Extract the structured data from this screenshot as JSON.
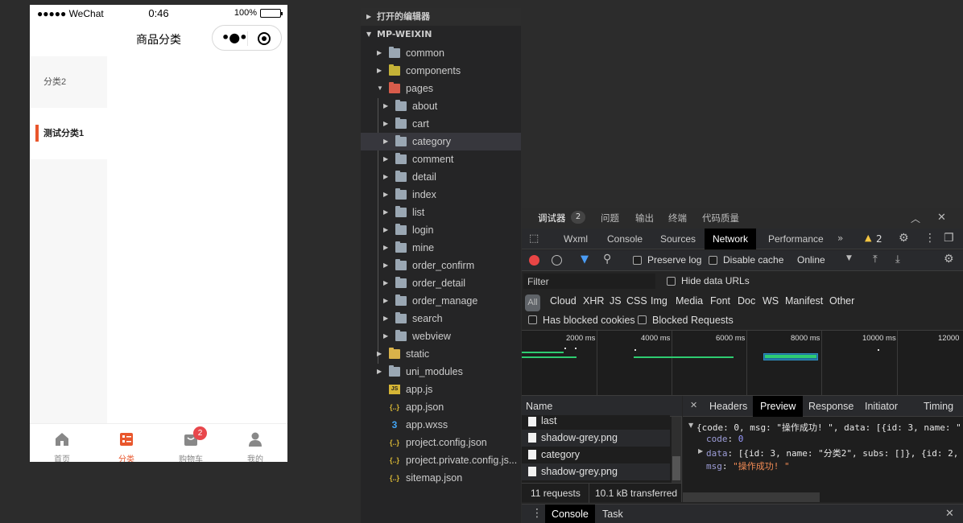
{
  "phone": {
    "status": {
      "signal": "●●●●● WeChat",
      "time": "0:46",
      "battery": "100%"
    },
    "nav_title": "商品分类",
    "categories": [
      {
        "label": "分类2",
        "active": false
      },
      {
        "label": "测试分类1",
        "active": true
      }
    ],
    "tabs": [
      {
        "label": "首页",
        "icon": "home-icon"
      },
      {
        "label": "分类",
        "icon": "category-icon"
      },
      {
        "label": "购物车",
        "icon": "cart-icon"
      },
      {
        "label": "我的",
        "icon": "user-icon"
      }
    ],
    "cart_badge": "2",
    "accent": "#e9562c"
  },
  "explorer": {
    "open_editors": "打开的编辑器",
    "project": "MP-WEIXIN",
    "items": [
      {
        "label": "common",
        "type": "folder"
      },
      {
        "label": "components",
        "type": "folder"
      },
      {
        "label": "pages",
        "type": "folder"
      },
      {
        "label": "about",
        "type": "folder"
      },
      {
        "label": "cart",
        "type": "folder"
      },
      {
        "label": "category",
        "type": "folder"
      },
      {
        "label": "comment",
        "type": "folder"
      },
      {
        "label": "detail",
        "type": "folder"
      },
      {
        "label": "index",
        "type": "folder"
      },
      {
        "label": "list",
        "type": "folder"
      },
      {
        "label": "login",
        "type": "folder"
      },
      {
        "label": "mine",
        "type": "folder"
      },
      {
        "label": "order_confirm",
        "type": "folder"
      },
      {
        "label": "order_detail",
        "type": "folder"
      },
      {
        "label": "order_manage",
        "type": "folder"
      },
      {
        "label": "search",
        "type": "folder"
      },
      {
        "label": "webview",
        "type": "folder"
      },
      {
        "label": "static",
        "type": "folder"
      },
      {
        "label": "uni_modules",
        "type": "folder"
      },
      {
        "label": "app.js",
        "type": "js"
      },
      {
        "label": "app.json",
        "type": "json"
      },
      {
        "label": "app.wxss",
        "type": "css"
      },
      {
        "label": "project.config.json",
        "type": "json"
      },
      {
        "label": "project.private.config.js...",
        "type": "json"
      },
      {
        "label": "sitemap.json",
        "type": "json"
      }
    ],
    "selected": "category"
  },
  "devtools": {
    "top_tabs": [
      "调试器",
      "问题",
      "输出",
      "终端",
      "代码质量"
    ],
    "debugger_count": "2",
    "panel_tabs": [
      "Wxml",
      "Console",
      "Sources",
      "Network",
      "Performance"
    ],
    "active_panel": "Network",
    "warning_count": "2",
    "toolbar": {
      "preserve_log": "Preserve log",
      "disable_cache": "Disable cache",
      "throttle": "Online"
    },
    "filter": {
      "placeholder": "Filter",
      "hide_data_urls": "Hide data URLs"
    },
    "types": [
      "All",
      "Cloud",
      "XHR",
      "JS",
      "CSS",
      "Img",
      "Media",
      "Font",
      "Doc",
      "WS",
      "Manifest",
      "Other"
    ],
    "has_blocked_cookies": "Has blocked cookies",
    "blocked_requests": "Blocked Requests",
    "timeline_labels": [
      "2000 ms",
      "4000 ms",
      "6000 ms",
      "8000 ms",
      "10000 ms",
      "12000"
    ],
    "name_header": "Name",
    "requests": [
      "last",
      "shadow-grey.png",
      "category",
      "shadow-grey.png"
    ],
    "summary": {
      "requests": "11 requests",
      "transferred": "10.1 kB transferred"
    },
    "preview_tabs": [
      "Headers",
      "Preview",
      "Response",
      "Initiator",
      "Timing"
    ],
    "active_preview": "Preview",
    "preview": {
      "line1": "{code: 0, msg: \"操作成功! \", data: [{id: 3, name: \"",
      "code_key": "code",
      "code_val": "0",
      "data_key": "data",
      "data_val": "[{id: 3, name: \"分类2\", subs: []}, {id: 2,",
      "msg_key": "msg",
      "msg_val": "\"操作成功! \""
    },
    "bottom_tabs": [
      "Console",
      "Task"
    ]
  }
}
